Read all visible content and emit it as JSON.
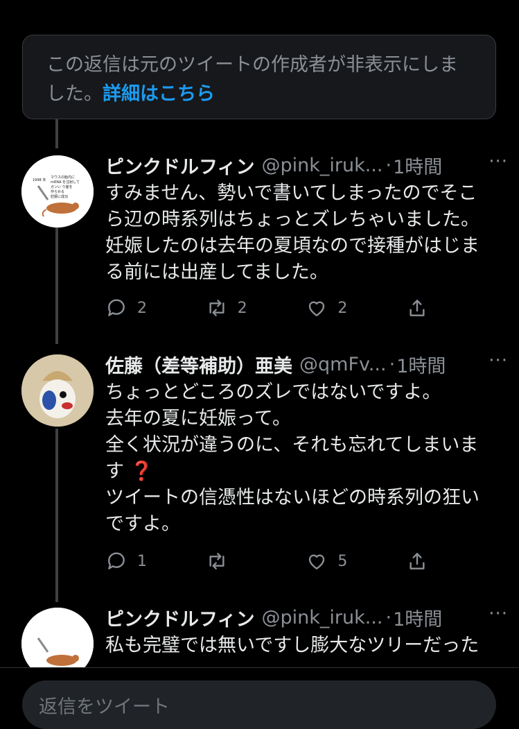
{
  "hidden_notice": {
    "text": "この返信は元のツイートの作成者が非表示にしました。",
    "link": "詳細はこちら"
  },
  "tweets": [
    {
      "name": "ピンクドルフィン",
      "handle": "@pink_iruk...",
      "dot": "·",
      "time": "1時間",
      "more": "···",
      "avatar_text": [
        "1998 年",
        "マウスの胎内に",
        "mRNA を注射して",
        "ガンい り産を",
        "作らせる",
        "妊娠に成功"
      ],
      "lines": [
        "すみません、勢いで書いてしまったのでそこ",
        "ら辺の時系列はちょっとズレちゃいました。",
        "妊娠したのは去年の夏頃なので接種がはじま",
        "る前には出産してました。"
      ],
      "reply_count": "2",
      "retweet_count": "2",
      "like_count": "2"
    },
    {
      "name": "佐藤（差等補助）亜美",
      "handle": "@qmFv...",
      "dot": "·",
      "time": "1時間",
      "more": "···",
      "lines": [
        "ちょっとどころのズレではないですよ。",
        "去年の夏に妊娠って。",
        "全く状況が違うのに、それも忘れてしまいま",
        "す",
        "ツイートの信憑性はないほどの時系列の狂い",
        "ですよ。"
      ],
      "question_emoji": "❓",
      "reply_count": "1",
      "retweet_count": "",
      "like_count": "5"
    },
    {
      "name": "ピンクドルフィン",
      "handle": "@pink_iruk...",
      "dot": "·",
      "time": "1時間",
      "more": "···",
      "lines": [
        "私も完璧では無いですし膨大なツリーだった"
      ]
    }
  ],
  "reply_placeholder": "返信をツイート",
  "colors": {
    "background": "#000000",
    "link": "#1d9bf0",
    "muted": "#8b9096",
    "text": "#e7e9ea"
  }
}
